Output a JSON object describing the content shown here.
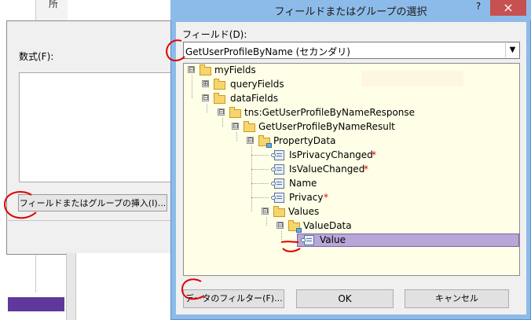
{
  "background_window": {
    "top_char": "所",
    "formula_label": "数式(F):",
    "insert_button_label": "フィールドまたはグループの挿入(I)...",
    "accent_color": "#60379a"
  },
  "dialog": {
    "title": "フィールドまたはグループの選択",
    "help_label": "?",
    "close_label": "×",
    "field_label": "フィールド(D):",
    "dropdown_value": "GetUserProfileByName (セカンダリ)",
    "tree": [
      {
        "label": "myFields",
        "type": "folder",
        "expander": "⊟"
      },
      {
        "label": "queryFields",
        "type": "folder",
        "expander": "⊞"
      },
      {
        "label": "dataFields",
        "type": "folder",
        "expander": "⊟"
      },
      {
        "label": "tns:GetUserProfileByNameResponse",
        "type": "folder",
        "expander": "⊟"
      },
      {
        "label": "GetUserProfileByNameResult",
        "type": "folder",
        "expander": "⊟"
      },
      {
        "label": "PropertyData",
        "type": "folder-repeat",
        "expander": "⊟"
      },
      {
        "label": "IsPrivacyChanged",
        "type": "field",
        "required": "*"
      },
      {
        "label": "IsValueChanged",
        "type": "field",
        "required": "*"
      },
      {
        "label": "Name",
        "type": "field",
        "required": ""
      },
      {
        "label": "Privacy",
        "type": "field",
        "required": "*"
      },
      {
        "label": "Values",
        "type": "folder",
        "expander": "⊟"
      },
      {
        "label": "ValueData",
        "type": "folder-repeat",
        "expander": "⊟"
      },
      {
        "label": "Value",
        "type": "field",
        "selected": true
      }
    ],
    "buttons": {
      "filter": "データのフィルター(F)...",
      "ok": "OK",
      "cancel": "キャンセル"
    },
    "colors": {
      "title_bar": "#8dbbe9",
      "tree_background": "#ffffe7",
      "selection": "#b8a7d6",
      "close_button": "#c75050",
      "annotation": "#e00000"
    }
  }
}
